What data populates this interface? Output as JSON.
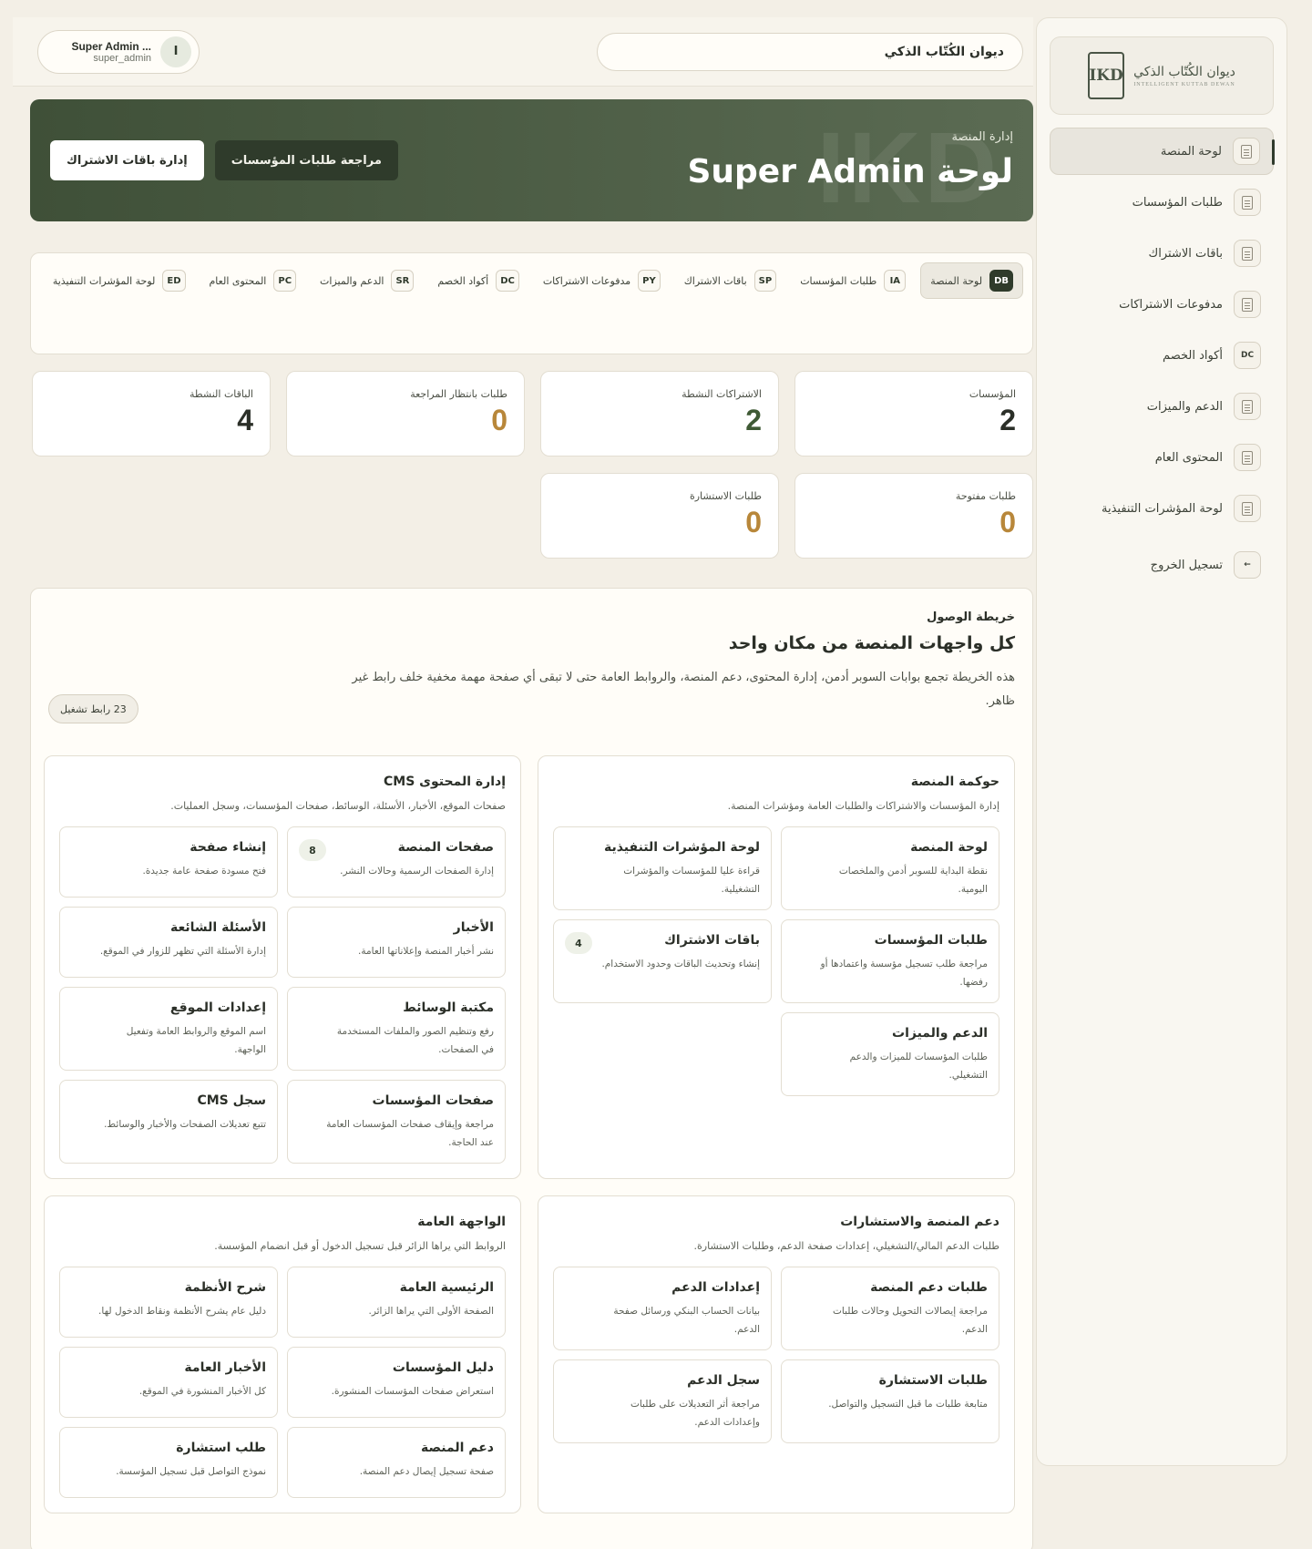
{
  "brand": {
    "logo_mark": "IKD",
    "logo_ar": "ديوان الكُتّاب الذكي",
    "logo_en": "INTELLIGENT KUTTAB DEWAN",
    "app_title": "ديوان الكُتّاب الذكي"
  },
  "user": {
    "initial": "I",
    "name": "Super Admin ...",
    "role": "super_admin"
  },
  "sidebar": {
    "items": [
      {
        "label": "لوحة المنصة"
      },
      {
        "label": "طلبات المؤسسات"
      },
      {
        "label": "باقات الاشتراك"
      },
      {
        "label": "مدفوعات الاشتراكات"
      },
      {
        "label": "أكواد الخصم",
        "code": "DC"
      },
      {
        "label": "الدعم والميزات"
      },
      {
        "label": "المحتوى العام"
      },
      {
        "label": "لوحة المؤشرات التنفيذية"
      }
    ],
    "logout": {
      "label": "تسجيل الخروج",
      "icon": "←"
    }
  },
  "hero": {
    "kicker": "إدارة المنصة",
    "title": "لوحة Super Admin",
    "watermark": "IKD",
    "review_button": "مراجعة طلبات المؤسسات",
    "plans_button": "إدارة باقات الاشتراك"
  },
  "tabs": [
    {
      "code": "DB",
      "label": "لوحة المنصة"
    },
    {
      "code": "IA",
      "label": "طلبات المؤسسات"
    },
    {
      "code": "SP",
      "label": "باقات الاشتراك"
    },
    {
      "code": "PY",
      "label": "مدفوعات الاشتراكات"
    },
    {
      "code": "DC",
      "label": "أكواد الخصم"
    },
    {
      "code": "SR",
      "label": "الدعم والميزات"
    },
    {
      "code": "PC",
      "label": "المحتوى العام"
    },
    {
      "code": "ED",
      "label": "لوحة المؤشرات التنفيذية"
    }
  ],
  "stats": [
    {
      "label": "المؤسسات",
      "value": "2",
      "color": "#2b2f28"
    },
    {
      "label": "الاشتراكات النشطة",
      "value": "2",
      "color": "#3f5a35"
    },
    {
      "label": "طلبات بانتظار المراجعة",
      "value": "0",
      "color": "#b8873a"
    },
    {
      "label": "الباقات النشطة",
      "value": "4",
      "color": "#2b2f28"
    },
    {
      "label": "طلبات مفتوحة",
      "value": "0",
      "color": "#b8873a"
    },
    {
      "label": "طلبات الاستشارة",
      "value": "0",
      "color": "#b8873a"
    }
  ],
  "access_map": {
    "kicker": "خريطة الوصول",
    "title": "كل واجهات المنصة من مكان واحد",
    "description": "هذه الخريطة تجمع بوابات السوبر أدمن، إدارة المحتوى، دعم المنصة، والروابط العامة حتى لا تبقى أي صفحة مهمة مخفية خلف رابط غير ظاهر.",
    "count_label": "23 رابط تشغيل",
    "sections": [
      {
        "title": "حوكمة المنصة",
        "description": "إدارة المؤسسات والاشتراكات والطلبات العامة ومؤشرات المنصة.",
        "cards": [
          {
            "title": "لوحة المنصة",
            "desc": "نقطة البداية للسوبر أدمن والملخصات اليومية.",
            "badge": ""
          },
          {
            "title": "لوحة المؤشرات التنفيذية",
            "desc": "قراءة عليا للمؤسسات والمؤشرات التشغيلية.",
            "badge": ""
          },
          {
            "title": "طلبات المؤسسات",
            "desc": "مراجعة طلب تسجيل مؤسسة واعتمادها أو رفضها.",
            "badge": ""
          },
          {
            "title": "باقات الاشتراك",
            "desc": "إنشاء وتحديث الباقات وحدود الاستخدام.",
            "badge": "4"
          },
          {
            "title": "الدعم والميزات",
            "desc": "طلبات المؤسسات للميزات والدعم التشغيلي.",
            "badge": ""
          }
        ]
      },
      {
        "title": "إدارة المحتوى CMS",
        "description": "صفحات الموقع، الأخبار، الأسئلة، الوسائط، صفحات المؤسسات، وسجل العمليات.",
        "cards": [
          {
            "title": "صفحات المنصة",
            "desc": "إدارة الصفحات الرسمية وحالات النشر.",
            "badge": "8"
          },
          {
            "title": "إنشاء صفحة",
            "desc": "فتح مسودة صفحة عامة جديدة.",
            "badge": ""
          },
          {
            "title": "الأخبار",
            "desc": "نشر أخبار المنصة وإعلاناتها العامة.",
            "badge": ""
          },
          {
            "title": "الأسئلة الشائعة",
            "desc": "إدارة الأسئلة التي تظهر للزوار في الموقع.",
            "badge": ""
          },
          {
            "title": "مكتبة الوسائط",
            "desc": "رفع وتنظيم الصور والملفات المستخدمة في الصفحات.",
            "badge": ""
          },
          {
            "title": "إعدادات الموقع",
            "desc": "اسم الموقع والروابط العامة وتفعيل الواجهة.",
            "badge": ""
          },
          {
            "title": "صفحات المؤسسات",
            "desc": "مراجعة وإيقاف صفحات المؤسسات العامة عند الحاجة.",
            "badge": ""
          },
          {
            "title": "سجل CMS",
            "desc": "تتبع تعديلات الصفحات والأخبار والوسائط.",
            "badge": ""
          }
        ]
      },
      {
        "title": "دعم المنصة والاستشارات",
        "description": "طلبات الدعم المالي/التشغيلي، إعدادات صفحة الدعم، وطلبات الاستشارة.",
        "cards": [
          {
            "title": "طلبات دعم المنصة",
            "desc": "مراجعة إيصالات التحويل وحالات طلبات الدعم.",
            "badge": ""
          },
          {
            "title": "إعدادات الدعم",
            "desc": "بيانات الحساب البنكي ورسائل صفحة الدعم.",
            "badge": ""
          },
          {
            "title": "طلبات الاستشارة",
            "desc": "متابعة طلبات ما قبل التسجيل والتواصل.",
            "badge": ""
          },
          {
            "title": "سجل الدعم",
            "desc": "مراجعة أثر التعديلات على طلبات وإعدادات الدعم.",
            "badge": ""
          }
        ]
      },
      {
        "title": "الواجهة العامة",
        "description": "الروابط التي يراها الزائر قبل تسجيل الدخول أو قبل انضمام المؤسسة.",
        "cards": [
          {
            "title": "الرئيسية العامة",
            "desc": "الصفحة الأولى التي يراها الزائر.",
            "badge": ""
          },
          {
            "title": "شرح الأنظمة",
            "desc": "دليل عام يشرح الأنظمة ونقاط الدخول لها.",
            "badge": ""
          },
          {
            "title": "دليل المؤسسات",
            "desc": "استعراض صفحات المؤسسات المنشورة.",
            "badge": ""
          },
          {
            "title": "الأخبار العامة",
            "desc": "كل الأخبار المنشورة في الموقع.",
            "badge": ""
          },
          {
            "title": "دعم المنصة",
            "desc": "صفحة تسجيل إيصال دعم المنصة.",
            "badge": ""
          },
          {
            "title": "طلب استشارة",
            "desc": "نموذج التواصل قبل تسجيل المؤسسة.",
            "badge": ""
          }
        ]
      }
    ]
  }
}
